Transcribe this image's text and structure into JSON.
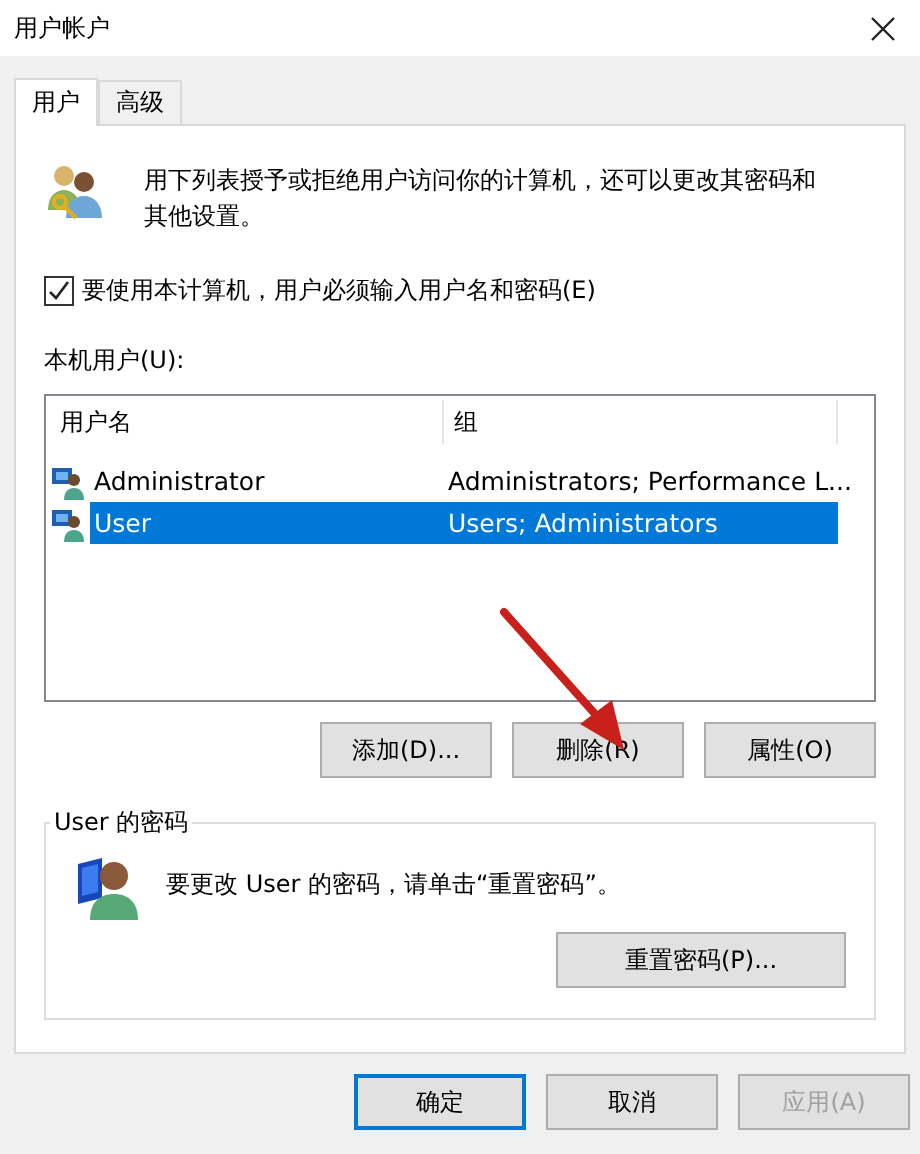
{
  "window": {
    "title": "用户帐户"
  },
  "tabs": [
    {
      "label": "用户",
      "selected": true
    },
    {
      "label": "高级",
      "selected": false
    }
  ],
  "description": "用下列表授予或拒绝用户访问你的计算机，还可以更改其密码和其他设置。",
  "require_login": {
    "label": "要使用本计算机，用户必须输入用户名和密码(E)",
    "checked": true
  },
  "list_label": "本机用户(U):",
  "table": {
    "columns": [
      "用户名",
      "组"
    ],
    "rows": [
      {
        "cells": [
          "Administrator",
          "Administrators; Performance L..."
        ],
        "selected": false
      },
      {
        "cells": [
          "User",
          "Users; Administrators"
        ],
        "selected": true
      }
    ]
  },
  "list_buttons": [
    "添加(D)...",
    "删除(R)",
    "属性(O)"
  ],
  "password_group": {
    "title": "User 的密码",
    "message": "要更改 User 的密码，请单击“重置密码”。",
    "button": "重置密码(P)..."
  },
  "dialog_buttons": [
    {
      "label": "确定",
      "default": true,
      "disabled": false
    },
    {
      "label": "取消",
      "default": false,
      "disabled": false
    },
    {
      "label": "应用(A)",
      "default": false,
      "disabled": true
    }
  ]
}
